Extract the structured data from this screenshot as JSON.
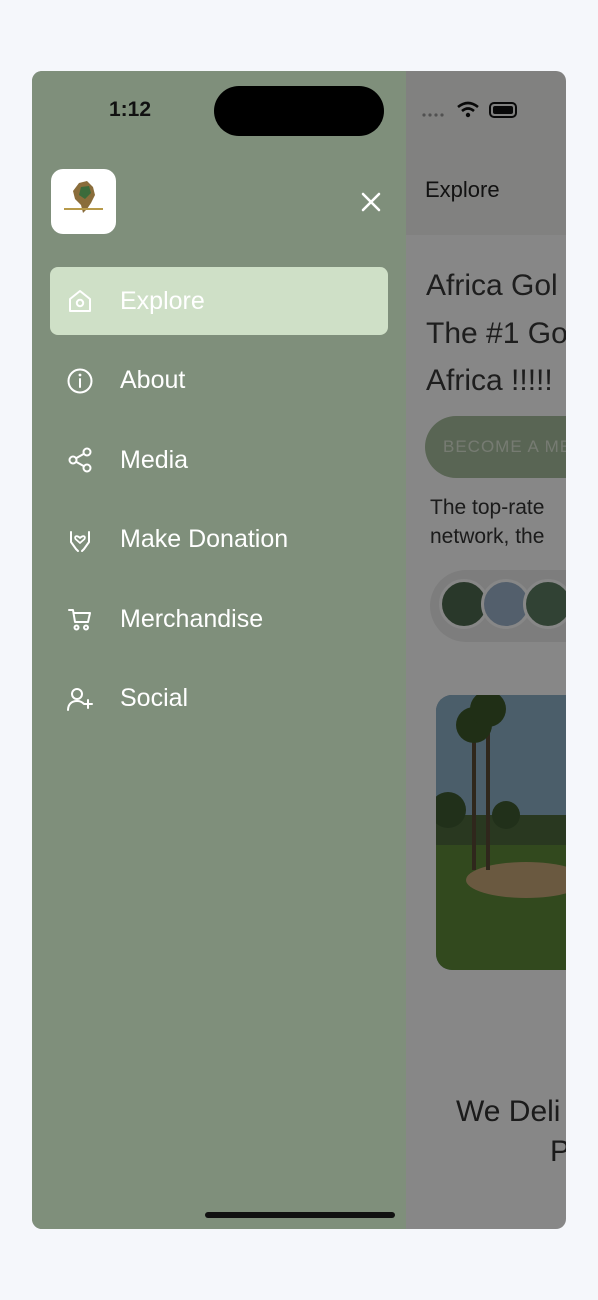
{
  "status": {
    "time": "1:12"
  },
  "drawer": {
    "close_icon": "close-icon",
    "items": [
      {
        "label": "Explore",
        "icon": "home-icon",
        "active": true
      },
      {
        "label": "About",
        "icon": "info-icon",
        "active": false
      },
      {
        "label": "Media",
        "icon": "share-icon",
        "active": false
      },
      {
        "label": "Make Donation",
        "icon": "donation-hands-icon",
        "active": false
      },
      {
        "label": "Merchandise",
        "icon": "cart-icon",
        "active": false
      },
      {
        "label": "Social",
        "icon": "add-user-icon",
        "active": false
      }
    ]
  },
  "page": {
    "header_title": "Explore",
    "hero_lines": [
      "Africa Gol",
      "The #1 Go",
      "Africa !!!!!"
    ],
    "cta_label": "BECOME A ME",
    "subtext_lines": [
      "The top-rate",
      "network, the"
    ],
    "bottom_title_lines": [
      "We Deli",
      "P"
    ]
  },
  "colors": {
    "drawer_bg": "#7f8f7b",
    "active_item_bg": "#cfe0c7",
    "cta_bg": "#a9bf9f",
    "page_bg": "#f5f7fb"
  }
}
